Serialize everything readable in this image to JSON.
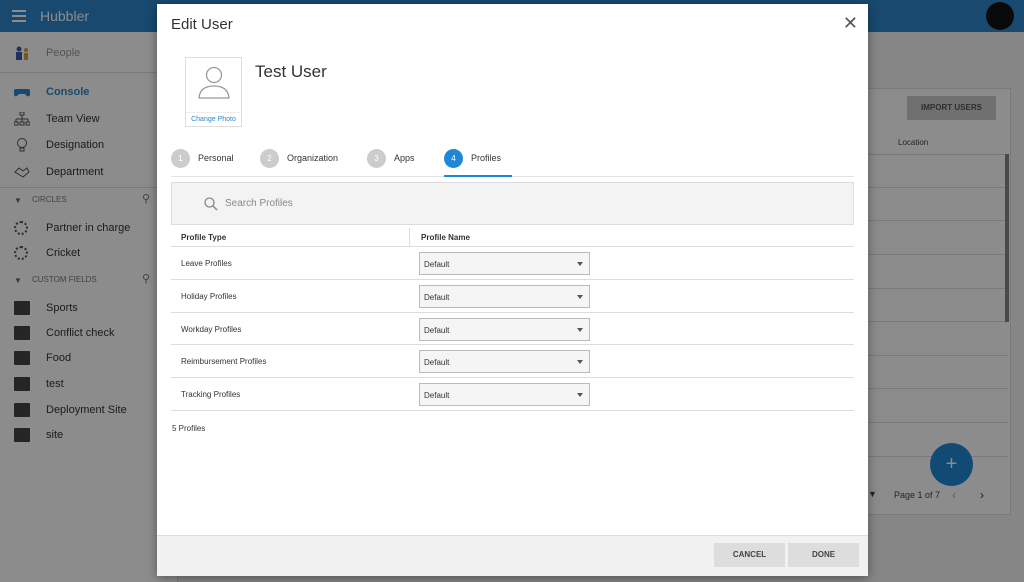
{
  "app": {
    "brand": "Hubbler"
  },
  "sidebar": {
    "top_item": {
      "label": "People"
    },
    "items": [
      {
        "label": "Console",
        "icon": "gamepad-icon",
        "active": true
      },
      {
        "label": "Team View",
        "icon": "org-chart-icon"
      },
      {
        "label": "Designation",
        "icon": "bulb-icon"
      },
      {
        "label": "Department",
        "icon": "handshake-icon"
      }
    ],
    "circles_section": {
      "label": "CIRCLES"
    },
    "circles": [
      {
        "label": "Partner in charge"
      },
      {
        "label": "Cricket"
      }
    ],
    "custom_fields_section": {
      "label": "CUSTOM FIELDS"
    },
    "custom_fields": [
      {
        "label": "Sports"
      },
      {
        "label": "Conflict check"
      },
      {
        "label": "Food"
      },
      {
        "label": "test"
      },
      {
        "label": "Deployment Site"
      },
      {
        "label": "site"
      }
    ]
  },
  "background": {
    "import_button": "IMPORT USERS",
    "location_header": "Location",
    "pager_text": "Page 1 of 7",
    "fab_label": "+"
  },
  "modal": {
    "title": "Edit User",
    "close_glyph": "✕",
    "change_photo": "Change Photo",
    "user_name": "Test User",
    "steps": [
      {
        "num": "1",
        "label": "Personal"
      },
      {
        "num": "2",
        "label": "Organization"
      },
      {
        "num": "3",
        "label": "Apps"
      },
      {
        "num": "4",
        "label": "Profiles",
        "active": true
      }
    ],
    "search_placeholder": "Search Profiles",
    "table": {
      "headers": [
        "Profile Type",
        "Profile Name"
      ],
      "rows": [
        {
          "type": "Leave Profiles",
          "value": "Default"
        },
        {
          "type": "Holiday Profiles",
          "value": "Default"
        },
        {
          "type": "Workday Profiles",
          "value": "Default"
        },
        {
          "type": "Reimbursement Profiles",
          "value": "Default"
        },
        {
          "type": "Tracking Profiles",
          "value": "Default"
        }
      ]
    },
    "count_text": "5 Profiles",
    "cancel_label": "CANCEL",
    "done_label": "DONE"
  },
  "colors": {
    "brand": "#2f86c8",
    "accent": "#1e88d6"
  }
}
